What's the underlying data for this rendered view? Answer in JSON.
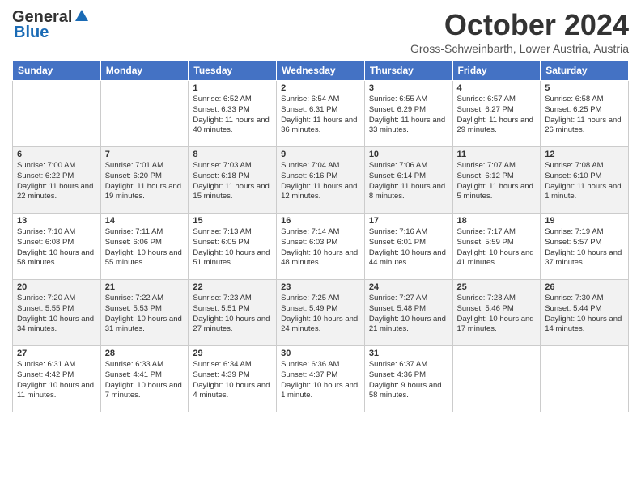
{
  "header": {
    "logo_general": "General",
    "logo_blue": "Blue",
    "month_title": "October 2024",
    "location": "Gross-Schweinbarth, Lower Austria, Austria"
  },
  "days_of_week": [
    "Sunday",
    "Monday",
    "Tuesday",
    "Wednesday",
    "Thursday",
    "Friday",
    "Saturday"
  ],
  "weeks": [
    [
      {
        "day": "",
        "sunrise": "",
        "sunset": "",
        "daylight": ""
      },
      {
        "day": "",
        "sunrise": "",
        "sunset": "",
        "daylight": ""
      },
      {
        "day": "1",
        "sunrise": "Sunrise: 6:52 AM",
        "sunset": "Sunset: 6:33 PM",
        "daylight": "Daylight: 11 hours and 40 minutes."
      },
      {
        "day": "2",
        "sunrise": "Sunrise: 6:54 AM",
        "sunset": "Sunset: 6:31 PM",
        "daylight": "Daylight: 11 hours and 36 minutes."
      },
      {
        "day": "3",
        "sunrise": "Sunrise: 6:55 AM",
        "sunset": "Sunset: 6:29 PM",
        "daylight": "Daylight: 11 hours and 33 minutes."
      },
      {
        "day": "4",
        "sunrise": "Sunrise: 6:57 AM",
        "sunset": "Sunset: 6:27 PM",
        "daylight": "Daylight: 11 hours and 29 minutes."
      },
      {
        "day": "5",
        "sunrise": "Sunrise: 6:58 AM",
        "sunset": "Sunset: 6:25 PM",
        "daylight": "Daylight: 11 hours and 26 minutes."
      }
    ],
    [
      {
        "day": "6",
        "sunrise": "Sunrise: 7:00 AM",
        "sunset": "Sunset: 6:22 PM",
        "daylight": "Daylight: 11 hours and 22 minutes."
      },
      {
        "day": "7",
        "sunrise": "Sunrise: 7:01 AM",
        "sunset": "Sunset: 6:20 PM",
        "daylight": "Daylight: 11 hours and 19 minutes."
      },
      {
        "day": "8",
        "sunrise": "Sunrise: 7:03 AM",
        "sunset": "Sunset: 6:18 PM",
        "daylight": "Daylight: 11 hours and 15 minutes."
      },
      {
        "day": "9",
        "sunrise": "Sunrise: 7:04 AM",
        "sunset": "Sunset: 6:16 PM",
        "daylight": "Daylight: 11 hours and 12 minutes."
      },
      {
        "day": "10",
        "sunrise": "Sunrise: 7:06 AM",
        "sunset": "Sunset: 6:14 PM",
        "daylight": "Daylight: 11 hours and 8 minutes."
      },
      {
        "day": "11",
        "sunrise": "Sunrise: 7:07 AM",
        "sunset": "Sunset: 6:12 PM",
        "daylight": "Daylight: 11 hours and 5 minutes."
      },
      {
        "day": "12",
        "sunrise": "Sunrise: 7:08 AM",
        "sunset": "Sunset: 6:10 PM",
        "daylight": "Daylight: 11 hours and 1 minute."
      }
    ],
    [
      {
        "day": "13",
        "sunrise": "Sunrise: 7:10 AM",
        "sunset": "Sunset: 6:08 PM",
        "daylight": "Daylight: 10 hours and 58 minutes."
      },
      {
        "day": "14",
        "sunrise": "Sunrise: 7:11 AM",
        "sunset": "Sunset: 6:06 PM",
        "daylight": "Daylight: 10 hours and 55 minutes."
      },
      {
        "day": "15",
        "sunrise": "Sunrise: 7:13 AM",
        "sunset": "Sunset: 6:05 PM",
        "daylight": "Daylight: 10 hours and 51 minutes."
      },
      {
        "day": "16",
        "sunrise": "Sunrise: 7:14 AM",
        "sunset": "Sunset: 6:03 PM",
        "daylight": "Daylight: 10 hours and 48 minutes."
      },
      {
        "day": "17",
        "sunrise": "Sunrise: 7:16 AM",
        "sunset": "Sunset: 6:01 PM",
        "daylight": "Daylight: 10 hours and 44 minutes."
      },
      {
        "day": "18",
        "sunrise": "Sunrise: 7:17 AM",
        "sunset": "Sunset: 5:59 PM",
        "daylight": "Daylight: 10 hours and 41 minutes."
      },
      {
        "day": "19",
        "sunrise": "Sunrise: 7:19 AM",
        "sunset": "Sunset: 5:57 PM",
        "daylight": "Daylight: 10 hours and 37 minutes."
      }
    ],
    [
      {
        "day": "20",
        "sunrise": "Sunrise: 7:20 AM",
        "sunset": "Sunset: 5:55 PM",
        "daylight": "Daylight: 10 hours and 34 minutes."
      },
      {
        "day": "21",
        "sunrise": "Sunrise: 7:22 AM",
        "sunset": "Sunset: 5:53 PM",
        "daylight": "Daylight: 10 hours and 31 minutes."
      },
      {
        "day": "22",
        "sunrise": "Sunrise: 7:23 AM",
        "sunset": "Sunset: 5:51 PM",
        "daylight": "Daylight: 10 hours and 27 minutes."
      },
      {
        "day": "23",
        "sunrise": "Sunrise: 7:25 AM",
        "sunset": "Sunset: 5:49 PM",
        "daylight": "Daylight: 10 hours and 24 minutes."
      },
      {
        "day": "24",
        "sunrise": "Sunrise: 7:27 AM",
        "sunset": "Sunset: 5:48 PM",
        "daylight": "Daylight: 10 hours and 21 minutes."
      },
      {
        "day": "25",
        "sunrise": "Sunrise: 7:28 AM",
        "sunset": "Sunset: 5:46 PM",
        "daylight": "Daylight: 10 hours and 17 minutes."
      },
      {
        "day": "26",
        "sunrise": "Sunrise: 7:30 AM",
        "sunset": "Sunset: 5:44 PM",
        "daylight": "Daylight: 10 hours and 14 minutes."
      }
    ],
    [
      {
        "day": "27",
        "sunrise": "Sunrise: 6:31 AM",
        "sunset": "Sunset: 4:42 PM",
        "daylight": "Daylight: 10 hours and 11 minutes."
      },
      {
        "day": "28",
        "sunrise": "Sunrise: 6:33 AM",
        "sunset": "Sunset: 4:41 PM",
        "daylight": "Daylight: 10 hours and 7 minutes."
      },
      {
        "day": "29",
        "sunrise": "Sunrise: 6:34 AM",
        "sunset": "Sunset: 4:39 PM",
        "daylight": "Daylight: 10 hours and 4 minutes."
      },
      {
        "day": "30",
        "sunrise": "Sunrise: 6:36 AM",
        "sunset": "Sunset: 4:37 PM",
        "daylight": "Daylight: 10 hours and 1 minute."
      },
      {
        "day": "31",
        "sunrise": "Sunrise: 6:37 AM",
        "sunset": "Sunset: 4:36 PM",
        "daylight": "Daylight: 9 hours and 58 minutes."
      },
      {
        "day": "",
        "sunrise": "",
        "sunset": "",
        "daylight": ""
      },
      {
        "day": "",
        "sunrise": "",
        "sunset": "",
        "daylight": ""
      }
    ]
  ]
}
